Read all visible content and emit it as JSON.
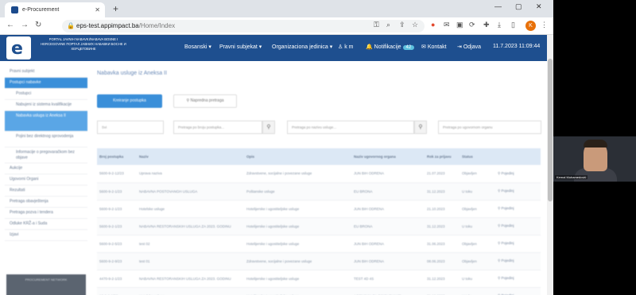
{
  "browser": {
    "tab_title": "e-Procurement",
    "new_tab": "+",
    "url_host": "eps-test.appimpact.ba",
    "url_path": "/Home/Index",
    "profile_initial": "K"
  },
  "header": {
    "portal_text": "PORTAL JAVNIH NABAVKI/NABAVA BOSNE I HERCEGOVINE ПОРТАЛ ЈАВНИХ НАБАВКИ БОСНЕ И ХЕРЦЕГОВИНЕ",
    "menu": {
      "language": "Bosanski",
      "legal_entity": "Pravni subjekat",
      "org_unit": "Organizaciona jedinica",
      "user": "k m",
      "notifications": "Notifikacije",
      "notifications_count": "42",
      "contact": "Kontakt",
      "logout": "Odjava",
      "datetime": "11.7.2023 11:09:44"
    }
  },
  "sidebar": {
    "items": [
      {
        "label": "Pravni subjekt"
      },
      {
        "label": "Postupci nabavke"
      },
      {
        "label": "Postupci"
      },
      {
        "label": "Nabujeni iz sistema kvalifikacije"
      },
      {
        "label": "Nabavka usluga iz Aneksa II"
      },
      {
        "label": "Pojini bez direktnog sprovodenja"
      },
      {
        "label": "Informacije o pregovaračkom bez objave"
      },
      {
        "label": "Aukcije"
      },
      {
        "label": "Ugovorni Organi"
      },
      {
        "label": "Rezultati"
      },
      {
        "label": "Pretraga obavještenja"
      },
      {
        "label": "Pretraga pozva i tendera"
      },
      {
        "label": "Odluke KRŽ-a i Suda"
      },
      {
        "label": "Izjavi"
      }
    ],
    "bottom_label": "PROCUREMENT NETWORK"
  },
  "main": {
    "title": "Nabavka usluge iz Aneksa II",
    "buttons": {
      "primary": "Kreiranje postupka",
      "secondary": "Napredna pretraga"
    },
    "filters": {
      "status": "Svi",
      "by_number": "Pretraga po broju postupka...",
      "by_name": "Pretraga po nazivu usluge...",
      "by_authority": "Pretraga po ugovornom organu"
    },
    "table": {
      "headers": [
        "Broj postupka",
        "Naziv",
        "Opis",
        "Naziv ugovornog organa",
        "Rok za prijavu",
        "Status",
        ""
      ],
      "rows": [
        [
          "5600-9-2-12/23",
          "Uprava naziva",
          "Zdravstvene, socijalne i povezane usluge",
          "JUN BIH ODRENA",
          "21.07.2023",
          "Objavljen",
          "Pojedinj"
        ],
        [
          "5600-9-2-1/23",
          "NABAVNA POSTOVANGH USLUGA",
          "Poštanske usluge",
          "EU BRONA",
          "31.12.2023",
          "U toku",
          "Pojedinj"
        ],
        [
          "5600-9-2-1/23",
          "Hotelske usluge",
          "Hotelijerske i ugostiteljske usluge",
          "JUN BIH ODRENA",
          "21.10.2023",
          "Objavljen",
          "Pojedinj"
        ],
        [
          "5600-9-2-1/23",
          "NABAVNA RESTORANSKIH USLUGA ZA 2023. GODINU",
          "Hotelijerske i ugostiteljske usluge",
          "EU BRONA",
          "31.12.2023",
          "U toku",
          "Pojedinj"
        ],
        [
          "5600-9-2-5/23",
          "test 02",
          "Hotelijerske i ugostiteljske usluge",
          "JUN BIH ODRENA",
          "31.06.2023",
          "Objavljen",
          "Pojedinj"
        ],
        [
          "5600-9-2-9/23",
          "test 01",
          "Zdravstvene, socijalne i povezane usluge",
          "JUN BIH ODRENA",
          "08.06.2023",
          "Objavljen",
          "Pojedinj"
        ],
        [
          "4470-9-2-1/23",
          "NABAVNA RESTORANSKIH USLUGA ZA 2023. GODINU",
          "Hotelijerske i ugostiteljske usluge",
          "TEST 4D 4S",
          "31.12.2023",
          "U toku",
          "Pojedinj"
        ],
        [
          "13-0-2-1/23",
          "Hotelske usluge",
          "Hotelijerske i ugostiteljske usluge",
          "AGENCIJA ZA OSIGURANJE",
          "31.12.2023",
          "U toku",
          "Pojedinj"
        ]
      ]
    }
  },
  "video": {
    "participant_name": "Kemal Muhamedović"
  },
  "colors": {
    "header_blue": "#1e4f8f",
    "accent_blue": "#3a8fd9",
    "badge": "#5bc0de",
    "profile_orange": "#e8710a"
  }
}
